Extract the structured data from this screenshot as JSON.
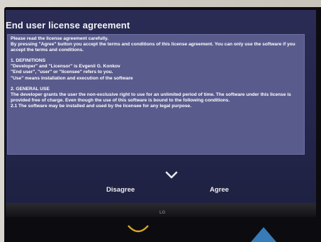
{
  "dialog": {
    "title": "End user license agreement",
    "paragraphs": [
      "Please read the license agreement carefully.",
      "By pressing \"Agree\" button you accept the terms and conditions of this license agreement. You can only use the software if you accept the terms and conditions.",
      "1. DEFINITIONS",
      "\"Developer\" and \"Licensor\" is Evgenii G. Konkov",
      "\"End user\", \"user\" or \"licensee\" refers to you.",
      "\"Use\" means installation and execution of the software",
      "2. GENERAL USE",
      "The developer grants the user the non-exclusive right to use for an unlimited period of time. The software under this license is provided free of charge. Even though the use of this software is bound to the following conditions.",
      "2.1 The software may be installed and used by the licensee for any legal purpose."
    ],
    "disagree_label": "Disagree",
    "agree_label": "Agree"
  },
  "device": {
    "brand": "LG"
  },
  "colors": {
    "screen_bg": "#2a2c55",
    "panel_bg": "#5a5b8d",
    "text": "#ffffff"
  }
}
